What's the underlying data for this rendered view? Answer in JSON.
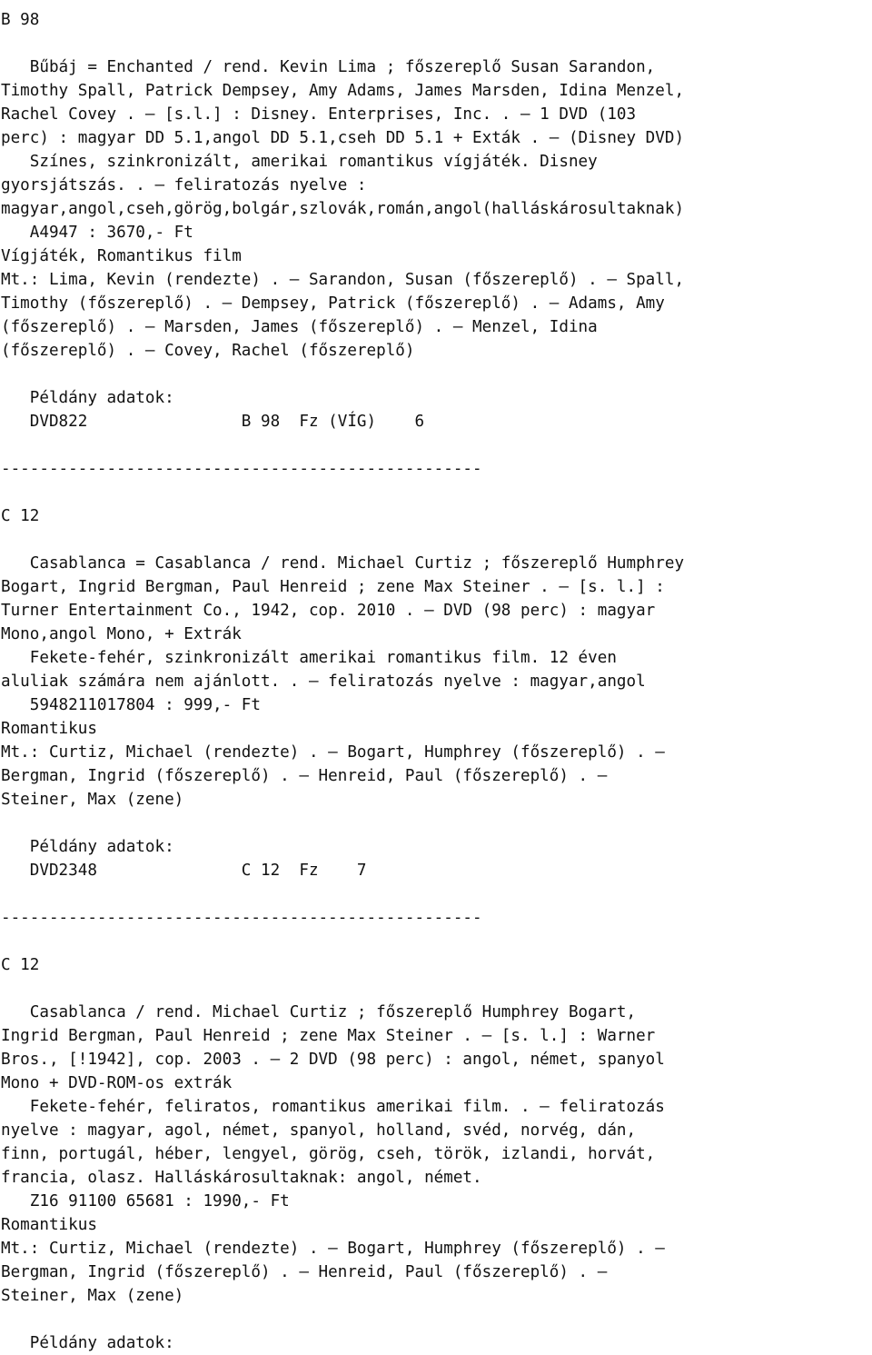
{
  "page": {
    "kind": "library-catalog-listing",
    "language": "hu",
    "font_char_width_px": 13.3,
    "line_height_px": 26
  },
  "entries": [
    {
      "call_number": "B 98",
      "record_lines": [
        "   Bűbáj = Enchanted / rend. Kevin Lima ; főszereplő Susan Sarandon,",
        "Timothy Spall, Patrick Dempsey, Amy Adams, James Marsden, Idina Menzel,",
        "Rachel Covey . — [s.l.] : Disney. Enterprises, Inc. . — 1 DVD (103",
        "perc) : magyar DD 5.1,angol DD 5.1,cseh DD 5.1 + Exták . — (Disney DVD)",
        "   Színes, szinkronizált, amerikai romantikus vígjáték. Disney",
        "gyorsjátszás. . — feliratozás nyelve :",
        "magyar,angol,cseh,görög,bolgár,szlovák,román,angol(halláskárosultaknak)",
        "   A4947 : 3670,- Ft",
        "Vígjáték, Romantikus film",
        "Mt.: Lima, Kevin (rendezte) . — Sarandon, Susan (főszereplő) . — Spall,",
        "Timothy (főszereplő) . — Dempsey, Patrick (főszereplő) . — Adams, Amy",
        "(főszereplő) . — Marsden, James (főszereplő) . — Menzel, Idina",
        "(főszereplő) . — Covey, Rachel (főszereplő)"
      ],
      "copies_label": "   Példány adatok:",
      "copies": [
        "   DVD822                B 98  Fz (VÍG)    6"
      ],
      "separator": "--------------------------------------------------"
    },
    {
      "call_number": "C 12",
      "record_lines": [
        "   Casablanca = Casablanca / rend. Michael Curtiz ; főszereplő Humphrey",
        "Bogart, Ingrid Bergman, Paul Henreid ; zene Max Steiner . — [s. l.] :",
        "Turner Entertainment Co., 1942, cop. 2010 . — DVD (98 perc) : magyar",
        "Mono,angol Mono, + Extrák",
        "   Fekete-fehér, szinkronizált amerikai romantikus film. 12 éven",
        "aluliak számára nem ajánlott. . — feliratozás nyelve : magyar,angol",
        "   5948211017804 : 999,- Ft",
        "Romantikus",
        "Mt.: Curtiz, Michael (rendezte) . — Bogart, Humphrey (főszereplő) . —",
        "Bergman, Ingrid (főszereplő) . — Henreid, Paul (főszereplő) . —",
        "Steiner, Max (zene)"
      ],
      "copies_label": "   Példány adatok:",
      "copies": [
        "   DVD2348               C 12  Fz    7"
      ],
      "separator": "--------------------------------------------------"
    },
    {
      "call_number": "C 12",
      "record_lines": [
        "   Casablanca / rend. Michael Curtiz ; főszereplő Humphrey Bogart,",
        "Ingrid Bergman, Paul Henreid ; zene Max Steiner . — [s. l.] : Warner",
        "Bros., [!1942], cop. 2003 . — 2 DVD (98 perc) : angol, német, spanyol",
        "Mono + DVD-ROM-os extrák",
        "   Fekete-fehér, feliratos, romantikus amerikai film. . — feliratozás",
        "nyelve : magyar, agol, német, spanyol, holland, svéd, norvég, dán,",
        "finn, portugál, héber, lengyel, görög, cseh, török, izlandi, horvát,",
        "francia, olasz. Halláskárosultaknak: angol, német.",
        "   Z16 91100 65681 : 1990,- Ft",
        "Romantikus",
        "Mt.: Curtiz, Michael (rendezte) . — Bogart, Humphrey (főszereplő) . —",
        "Bergman, Ingrid (főszereplő) . — Henreid, Paul (főszereplő) . —",
        "Steiner, Max (zene)"
      ],
      "copies_label": "   Példány adatok:",
      "copies": [],
      "separator": ""
    }
  ]
}
